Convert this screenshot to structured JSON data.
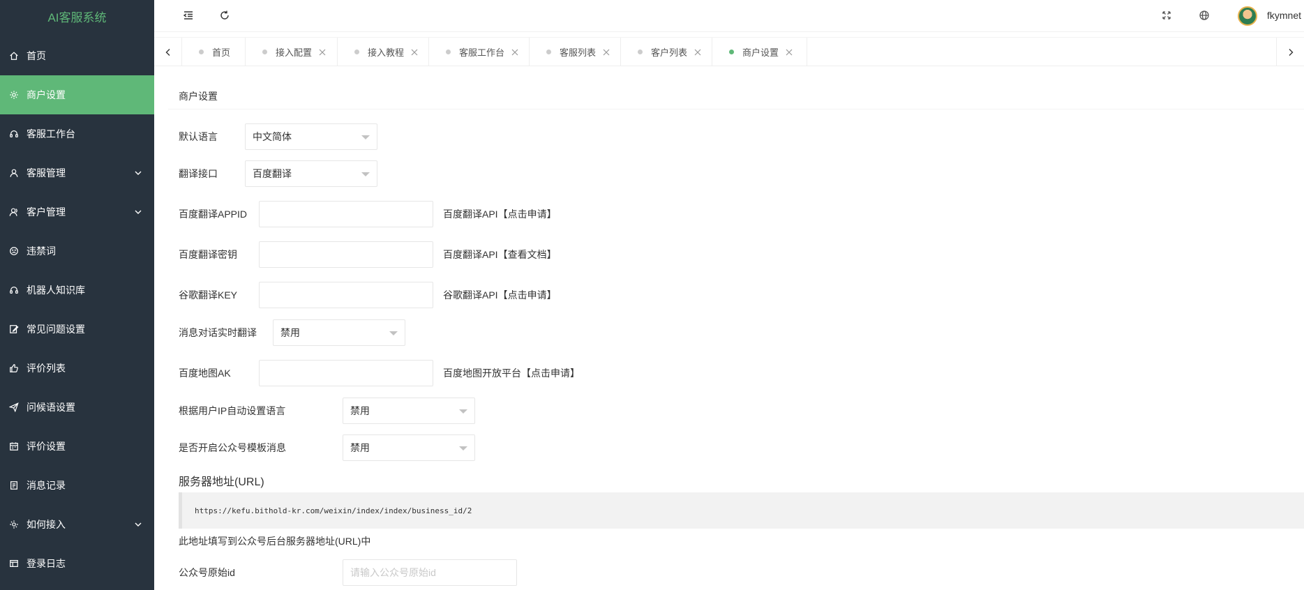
{
  "app": {
    "title": "AI客服系统"
  },
  "sidebar": {
    "items": [
      {
        "label": "首页",
        "icon": "home-icon"
      },
      {
        "label": "商户设置",
        "icon": "gear-icon",
        "active": true
      },
      {
        "label": "客服工作台",
        "icon": "headset-icon"
      },
      {
        "label": "客服管理",
        "icon": "user-icon",
        "expandable": true
      },
      {
        "label": "客户管理",
        "icon": "users-icon",
        "expandable": true
      },
      {
        "label": "违禁词",
        "icon": "sad-face-icon"
      },
      {
        "label": "机器人知识库",
        "icon": "headset-icon"
      },
      {
        "label": "常见问题设置",
        "icon": "edit-icon"
      },
      {
        "label": "评价列表",
        "icon": "thumbs-up-icon"
      },
      {
        "label": "问候语设置",
        "icon": "send-icon"
      },
      {
        "label": "评价设置",
        "icon": "calendar-icon"
      },
      {
        "label": "消息记录",
        "icon": "file-icon"
      },
      {
        "label": "如何接入",
        "icon": "settings-icon",
        "expandable": true
      },
      {
        "label": "登录日志",
        "icon": "table-icon"
      }
    ]
  },
  "header": {
    "username": "fkymnet"
  },
  "tabs": [
    {
      "label": "首页",
      "closable": false
    },
    {
      "label": "接入配置",
      "closable": true
    },
    {
      "label": "接入教程",
      "closable": true
    },
    {
      "label": "客服工作台",
      "closable": true
    },
    {
      "label": "客服列表",
      "closable": true
    },
    {
      "label": "客户列表",
      "closable": true
    },
    {
      "label": "商户设置",
      "closable": true,
      "active": true
    }
  ],
  "form": {
    "card_title": "商户设置",
    "default_language": {
      "label": "默认语言",
      "value": "中文简体"
    },
    "translate_api": {
      "label": "翻译接口",
      "value": "百度翻译"
    },
    "baidu_appid": {
      "label": "百度翻译APPID",
      "value": "",
      "hint": "百度翻译API【点击申请】"
    },
    "baidu_secret": {
      "label": "百度翻译密钥",
      "value": "",
      "hint": "百度翻译API【查看文档】"
    },
    "google_key": {
      "label": "谷歌翻译KEY",
      "value": "",
      "hint": "谷歌翻译API【点击申请】"
    },
    "realtime_translate": {
      "label": "消息对话实时翻译",
      "value": "禁用"
    },
    "baidu_map_ak": {
      "label": "百度地图AK",
      "value": "",
      "hint": "百度地图开放平台【点击申请】"
    },
    "ip_auto_language": {
      "label": "根据用户IP自动设置语言",
      "value": "禁用"
    },
    "wechat_template": {
      "label": "是否开启公众号模板消息",
      "value": "禁用"
    },
    "server_url": {
      "title": "服务器地址(URL)",
      "value": "https://kefu.bithold-kr.com/weixin/index/index/business_id/2",
      "note": "此地址填写到公众号后台服务器地址(URL)中"
    },
    "wechat_original_id": {
      "label": "公众号原始id",
      "placeholder": "请输入公众号原始id"
    }
  }
}
